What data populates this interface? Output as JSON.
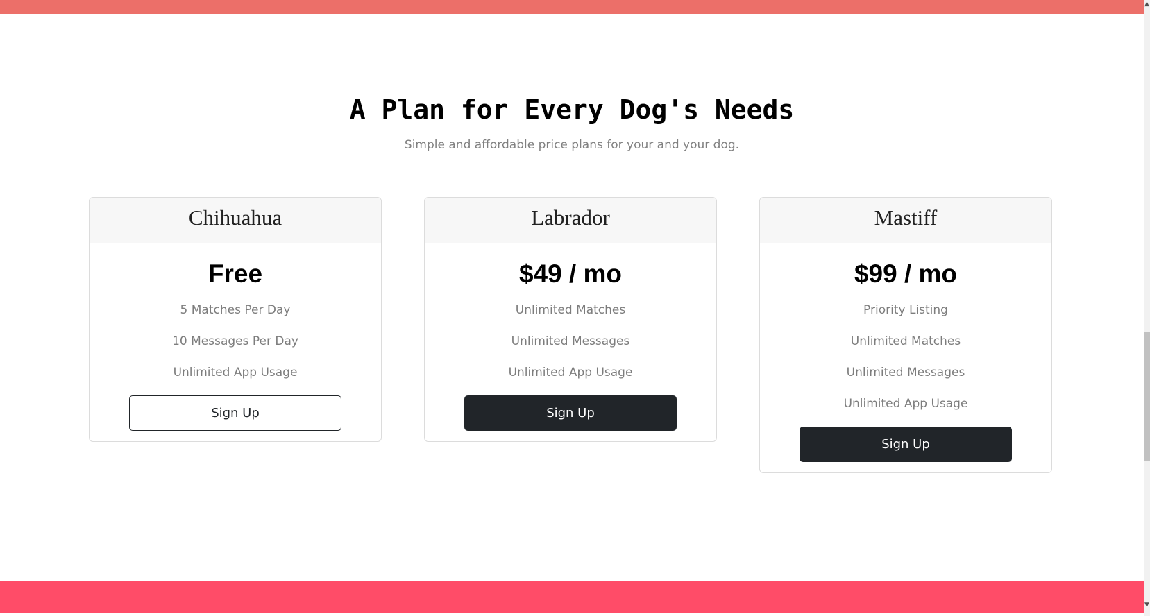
{
  "section": {
    "title": "A Plan for Every Dog's Needs",
    "subtitle": "Simple and affordable price plans for your and your dog."
  },
  "plans": [
    {
      "name": "Chihuahua",
      "price": "Free",
      "features": [
        "5 Matches Per Day",
        "10 Messages Per Day",
        "Unlimited App Usage"
      ],
      "button": "Sign Up",
      "button_style": "outline"
    },
    {
      "name": "Labrador",
      "price": "$49 / mo",
      "features": [
        "Unlimited Matches",
        "Unlimited Messages",
        "Unlimited App Usage"
      ],
      "button": "Sign Up",
      "button_style": "solid"
    },
    {
      "name": "Mastiff",
      "price": "$99 / mo",
      "features": [
        "Priority Listing",
        "Unlimited Matches",
        "Unlimited Messages",
        "Unlimited App Usage"
      ],
      "button": "Sign Up",
      "button_style": "solid"
    }
  ],
  "colors": {
    "top_band": "#ec6f69",
    "bottom_band": "#ff4c68",
    "dark_button": "#212529"
  },
  "scrollbar": {
    "up_icon": "chevron-up-icon",
    "down_icon": "chevron-down-icon"
  }
}
